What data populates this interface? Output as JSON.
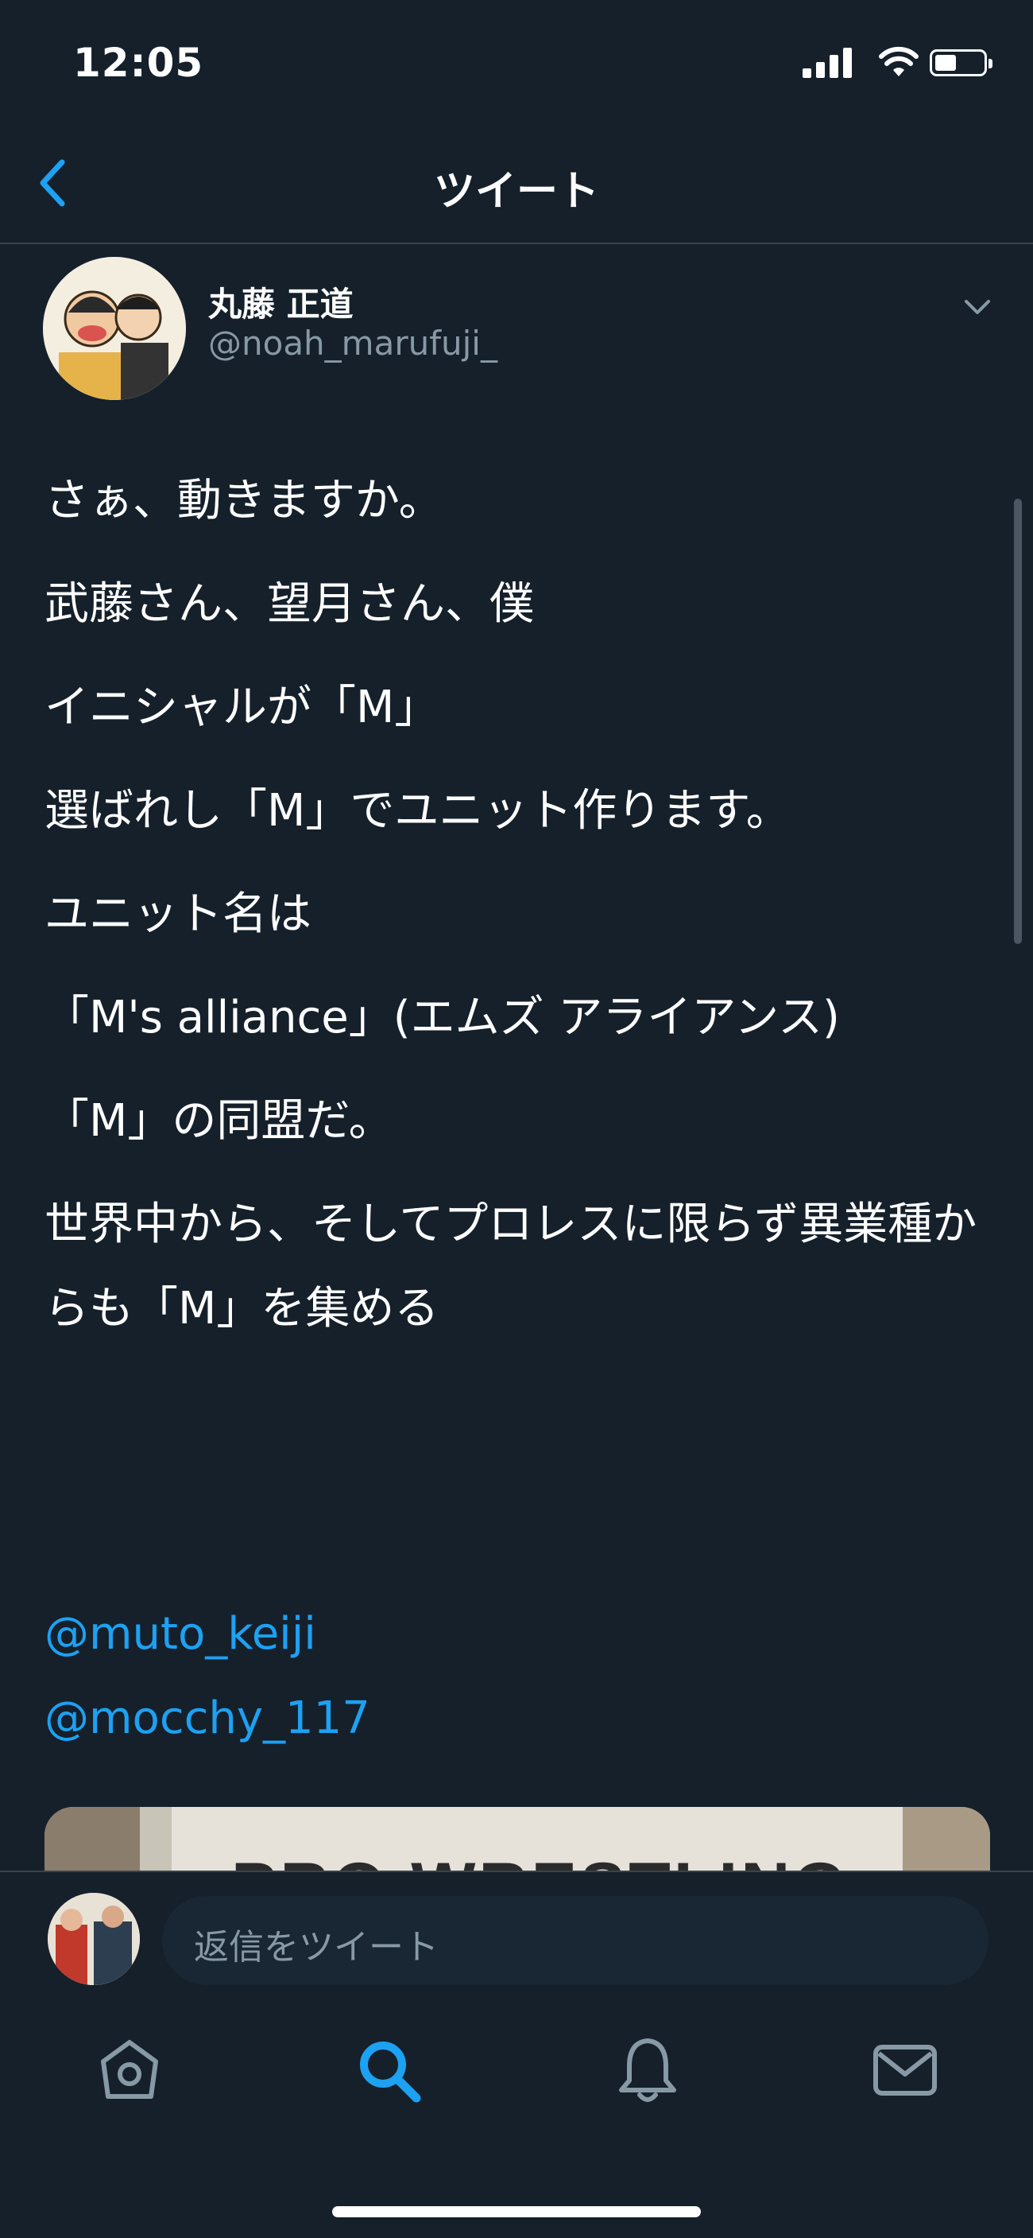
{
  "status_bar": {
    "time": "12:05",
    "icons": [
      "signal-icon",
      "wifi-icon",
      "battery-icon"
    ],
    "battery_level": 0.35
  },
  "header": {
    "title": "ツイート",
    "back_icon": "chevron-left-icon"
  },
  "tweet": {
    "author_name": "丸藤 正道",
    "author_handle": "@noah_marufuji_",
    "lines": [
      "さぁ、動きますか。",
      "武藤さん、望月さん、僕",
      "イニシャルが「M」",
      "選ばれし「M」でユニット作ります。",
      "ユニット名は",
      "「M's alliance」(エムズ アライアンス)",
      "「M」の同盟だ。",
      "世界中から、そしてプロレスに限らず異業種からも「M」を集める"
    ],
    "mentions": [
      "@muto_keiji",
      "@mocchy_117"
    ],
    "media_text": "PRO WRESTLING"
  },
  "reply": {
    "placeholder": "返信をツイート"
  },
  "tabs": [
    {
      "name": "home",
      "icon": "home-icon",
      "active": false
    },
    {
      "name": "search",
      "icon": "search-icon",
      "active": true
    },
    {
      "name": "notifications",
      "icon": "bell-icon",
      "active": false
    },
    {
      "name": "messages",
      "icon": "mail-icon",
      "active": false
    }
  ],
  "colors": {
    "background": "#15202b",
    "accent": "#1da1f2",
    "secondary_text": "#8899a6",
    "border": "#38444d"
  }
}
